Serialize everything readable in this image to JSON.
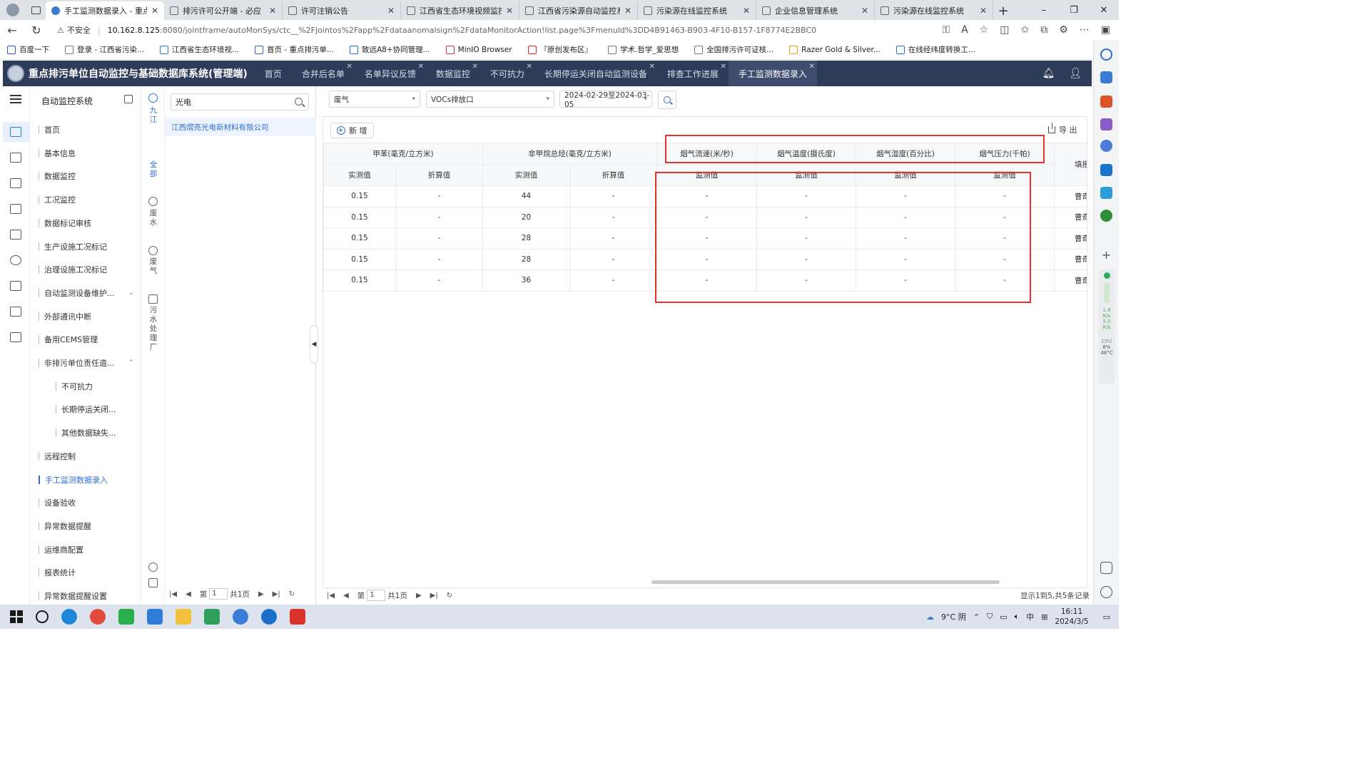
{
  "browser": {
    "tabs": [
      {
        "title": "手工监测数据录入 - 重点排",
        "active": true
      },
      {
        "title": "排污许可公开端 - 必应",
        "active": false
      },
      {
        "title": "许可注销公告",
        "active": false
      },
      {
        "title": "江西省生态环境视频监控平",
        "active": false
      },
      {
        "title": "江西省污染源自动监控系统",
        "active": false
      },
      {
        "title": "污染源在线监控系统",
        "active": false
      },
      {
        "title": "企业信息管理系统",
        "active": false
      },
      {
        "title": "污染源在线监控系统",
        "active": false
      }
    ],
    "security_label": "不安全",
    "url_host": "10.162.8.125",
    "url_path": ":8080/jointframe/autoMonSys/ctc__%2Fjointos%2Fapp%2Fdataanomalsign%2FdataMonitorAction!list.page%3Fmenuld%3DD4B91463-B903-4F10-B157-1F8774E2BBC0",
    "bookmarks": [
      "百度一下",
      "登录 - 江西省污染...",
      "江西省生态环境视...",
      "首页 - 重点排污单...",
      "致远A8+协同管理...",
      "MinIO Browser",
      "『原创发布区』",
      "学术.哲学_爱思想",
      "全国排污许可证核...",
      "Razer Gold & Silver...",
      "在线经纬度转换工..."
    ],
    "edge_monitor": {
      "net_up": "1.8",
      "net_up_unit": "K/s",
      "net_down": "5.0",
      "net_down_unit": "K/s",
      "cpu_label": "CPU",
      "cpu": "8%",
      "temp": "48°C"
    }
  },
  "app": {
    "title": "重点排污单位自动监控与基础数据库系统(管理端)",
    "tabs": [
      {
        "label": "首页",
        "closable": false,
        "active": false
      },
      {
        "label": "合并后名单",
        "closable": true,
        "active": false
      },
      {
        "label": "名单异议反馈",
        "closable": true,
        "active": false
      },
      {
        "label": "数据监控",
        "closable": true,
        "active": false
      },
      {
        "label": "不可抗力",
        "closable": true,
        "active": false
      },
      {
        "label": "长期停运关闭自动监测设备",
        "closable": true,
        "active": false
      },
      {
        "label": "排查工作进展",
        "closable": true,
        "active": false
      },
      {
        "label": "手工监测数据录入",
        "closable": true,
        "active": true
      }
    ]
  },
  "menu": {
    "title": "自动监控系统",
    "items": [
      {
        "label": "首页",
        "level": 1
      },
      {
        "label": "基本信息",
        "level": 1
      },
      {
        "label": "数据监控",
        "level": 1
      },
      {
        "label": "工况监控",
        "level": 1
      },
      {
        "label": "数据标记审核",
        "level": 1
      },
      {
        "label": "生产设施工况标记",
        "level": 1
      },
      {
        "label": "治理设施工况标记",
        "level": 1
      },
      {
        "label": "自动监测设备维护...",
        "level": 1,
        "expand": "v"
      },
      {
        "label": "外部通讯中断",
        "level": 1
      },
      {
        "label": "备用CEMS管理",
        "level": 1
      },
      {
        "label": "非排污单位责任造...",
        "level": 1,
        "expand": "^"
      },
      {
        "label": "不可抗力",
        "level": 2
      },
      {
        "label": "长期停运关闭...",
        "level": 2
      },
      {
        "label": "其他数据缺失...",
        "level": 2
      },
      {
        "label": "远程控制",
        "level": 1
      },
      {
        "label": "手工监测数据录入",
        "level": 1,
        "active": true
      },
      {
        "label": "设备验收",
        "level": 1
      },
      {
        "label": "异常数据提醒",
        "level": 1
      },
      {
        "label": "运维商配置",
        "level": 1
      },
      {
        "label": "报表统计",
        "level": 1
      },
      {
        "label": "异常数据提醒设置",
        "level": 1
      }
    ]
  },
  "regions": {
    "city": "九江",
    "all": "全部",
    "wastewater": "废水",
    "wastegas": "废气",
    "sewage_plant": "污水处理厂"
  },
  "company_panel": {
    "search_value": "光电",
    "items": [
      "江西熠亮光电新材料有限公司"
    ],
    "pager": {
      "page_prefix": "第",
      "page": "1",
      "total": "共1页"
    }
  },
  "filters": {
    "type": "废气",
    "outlet": "VOCs排放口",
    "date_range": "2024-02-29至2024-03-05"
  },
  "toolbar": {
    "add": "新 增",
    "export": "导 出"
  },
  "table": {
    "groups": [
      "甲苯(毫克/立方米)",
      "非甲烷总烃(毫克/立方米)",
      "烟气流速(米/秒)",
      "烟气温度(摄氏度)",
      "烟气湿度(百分比)",
      "烟气压力(千帕)",
      "填报人"
    ],
    "subheaders": [
      "实测值",
      "折算值",
      "实测值",
      "折算值",
      "监测值",
      "监测值",
      "监测值",
      "监测值"
    ],
    "rows": [
      [
        "0.15",
        "-",
        "44",
        "-",
        "-",
        "-",
        "-",
        "-",
        "曹奇"
      ],
      [
        "0.15",
        "-",
        "20",
        "-",
        "-",
        "-",
        "-",
        "-",
        "曹奇"
      ],
      [
        "0.15",
        "-",
        "28",
        "-",
        "-",
        "-",
        "-",
        "-",
        "曹奇"
      ],
      [
        "0.15",
        "-",
        "28",
        "-",
        "-",
        "-",
        "-",
        "-",
        "曹奇"
      ],
      [
        "0.15",
        "-",
        "36",
        "-",
        "-",
        "-",
        "-",
        "-",
        "曹奇"
      ]
    ],
    "pager": {
      "page_prefix": "第",
      "page": "1",
      "total": "共1页"
    },
    "record_info": "显示1到5,共5条记录"
  },
  "taskbar": {
    "weather": "9°C 阴",
    "ime": "中",
    "time": "16:11",
    "date": "2024/3/5"
  },
  "colors": {
    "accent": "#2f6fd2",
    "header_bg": "#2e3b59",
    "annotation": "#e5322d"
  }
}
